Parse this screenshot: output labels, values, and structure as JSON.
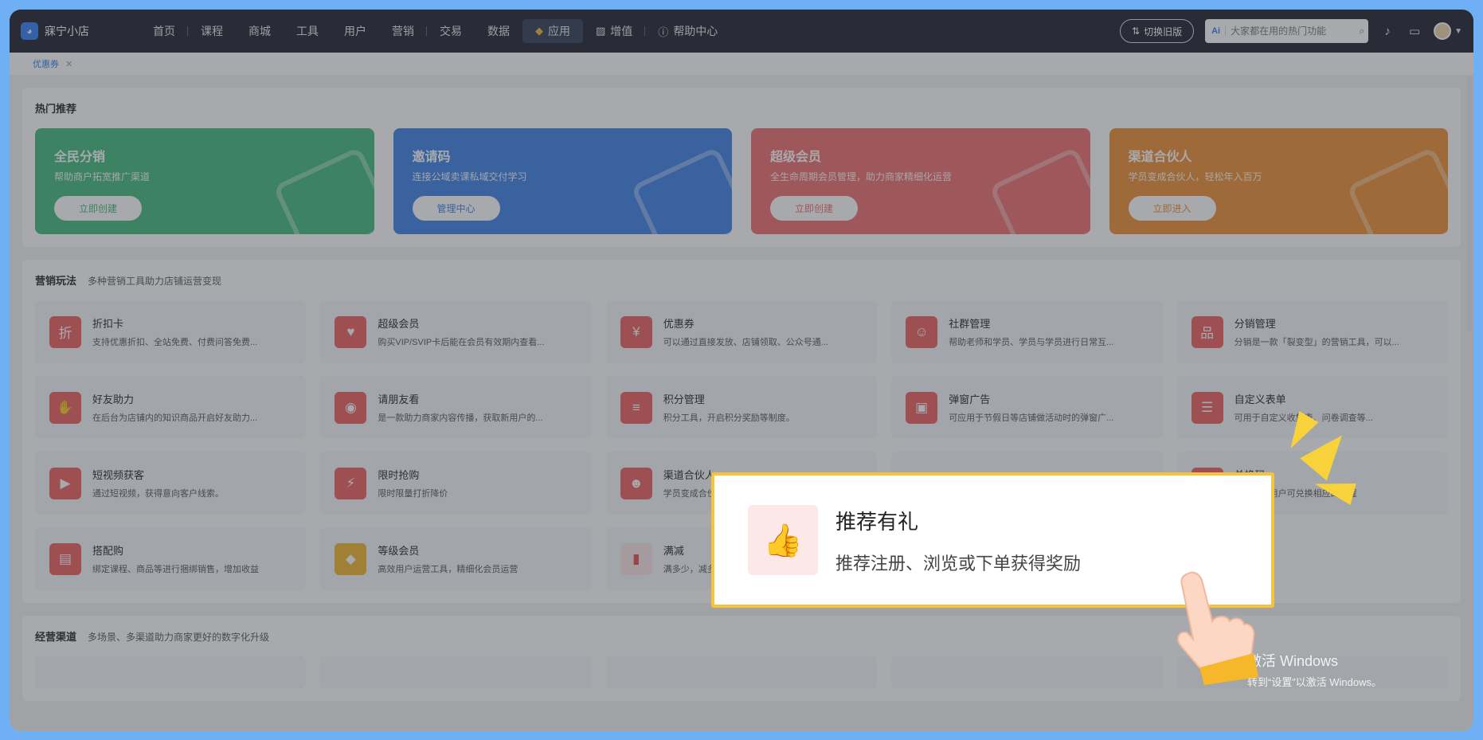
{
  "brand": {
    "name": "寐宁小店"
  },
  "nav": {
    "items": [
      {
        "label": "首页"
      },
      {
        "label": "课程"
      },
      {
        "label": "商城"
      },
      {
        "label": "工具"
      },
      {
        "label": "用户"
      },
      {
        "label": "营销"
      },
      {
        "label": "交易"
      },
      {
        "label": "数据"
      }
    ],
    "app_label": "应用",
    "value_label": "增值",
    "help_label": "帮助中心"
  },
  "header": {
    "switch_label": "切换旧版",
    "search_ai": "Ai",
    "search_placeholder": "大家都在用的热门功能"
  },
  "tabs": [
    {
      "label": "优惠券"
    }
  ],
  "hot": {
    "title": "热门推荐",
    "cards": [
      {
        "title": "全民分销",
        "desc": "帮助商户拓宽推广渠道",
        "button": "立即创建",
        "color": "#3fb87a"
      },
      {
        "title": "邀请码",
        "desc": "连接公域卖课私域交付学习",
        "button": "管理中心",
        "color": "#3a7ee8"
      },
      {
        "title": "超级会员",
        "desc": "全生命周期会员管理，助力商家精细化运营",
        "button": "立即创建",
        "color": "#ef6a6a"
      },
      {
        "title": "渠道合伙人",
        "desc": "学员变成合伙人，轻松年入百万",
        "button": "立即进入",
        "color": "#f08c2e"
      }
    ]
  },
  "marketing": {
    "title": "营销玩法",
    "subtitle": "多种营销工具助力店铺运营变现",
    "tools": [
      {
        "name": "折扣卡",
        "desc": "支持优惠折扣、全站免费、付费问答免费...",
        "icon": "折"
      },
      {
        "name": "超级会员",
        "desc": "购买VIP/SVIP卡后能在会员有效期内查看...",
        "icon": "♥"
      },
      {
        "name": "优惠券",
        "desc": "可以通过直接发放、店铺领取、公众号通...",
        "icon": "¥"
      },
      {
        "name": "社群管理",
        "desc": "帮助老师和学员、学员与学员进行日常互...",
        "icon": "☺"
      },
      {
        "name": "分销管理",
        "desc": "分销是一款「裂变型」的营销工具，可以...",
        "icon": "品"
      },
      {
        "name": "好友助力",
        "desc": "在后台为店铺内的知识商品开启好友助力...",
        "icon": "✋"
      },
      {
        "name": "请朋友看",
        "desc": "是一款助力商家内容传播，获取新用户的...",
        "icon": "◉"
      },
      {
        "name": "积分管理",
        "desc": "积分工具，开启积分奖励等制度。",
        "icon": "≡"
      },
      {
        "name": "弹窗广告",
        "desc": "可应用于节假日等店铺做活动时的弹窗广...",
        "icon": "▣"
      },
      {
        "name": "自定义表单",
        "desc": "可用于自定义收集表、问卷调查等...",
        "icon": "☰"
      },
      {
        "name": "短视频获客",
        "desc": "通过短视频，获得意向客户线索。",
        "icon": "▶"
      },
      {
        "name": "限时抢购",
        "desc": "限时限量打折降价",
        "icon": "⚡"
      },
      {
        "name": "渠道合伙人",
        "desc": "学员变成合伙人",
        "icon": "☻"
      },
      {
        "name": "兑换码",
        "desc": "兑换码，用户可兑换相应的课程",
        "icon": "✉"
      },
      {
        "name": "搭配购",
        "desc": "绑定课程、商品等进行捆绑销售，增加收益",
        "icon": "▤"
      },
      {
        "name": "等级会员",
        "desc": "高效用户运营工具，精细化会员运营",
        "icon": "◆"
      },
      {
        "name": "满减",
        "desc": "满多少，减多少",
        "icon": "▮"
      }
    ]
  },
  "channels": {
    "title": "经营渠道",
    "subtitle": "多场景、多渠道助力商家更好的数字化升级"
  },
  "highlight": {
    "title": "推荐有礼",
    "desc": "推荐注册、浏览或下单获得奖励",
    "icon": "thumbs-up-icon"
  },
  "watermark": {
    "title": "激活 Windows",
    "sub": "转到“设置”以激活 Windows。"
  }
}
